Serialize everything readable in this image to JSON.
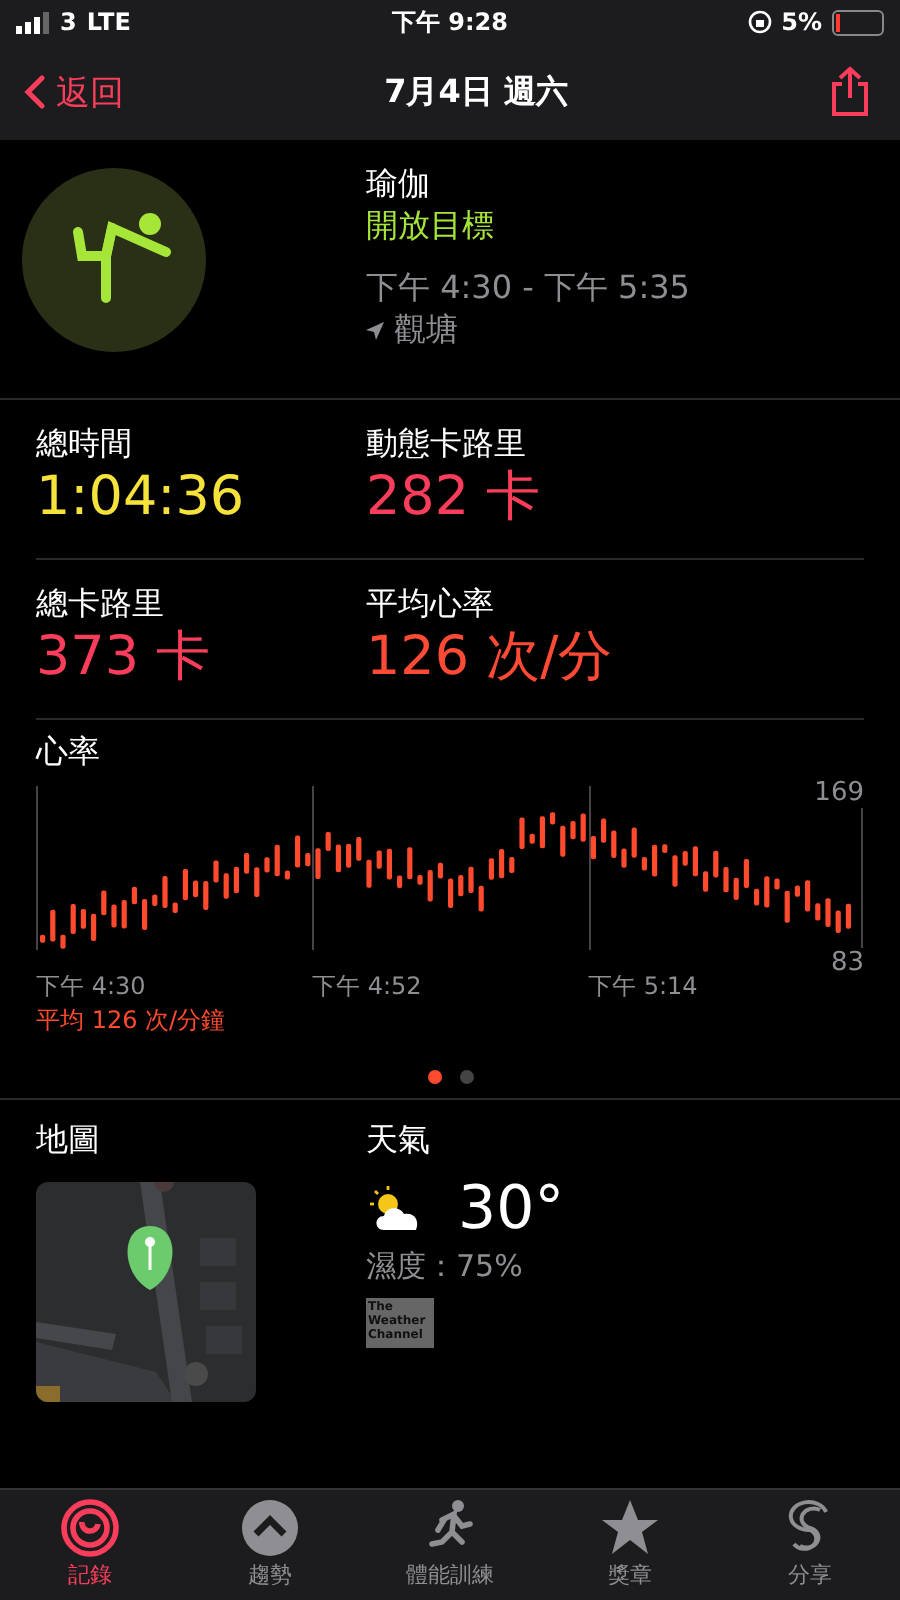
{
  "status_bar": {
    "carrier": "3",
    "network": "LTE",
    "time": "下午 9:28",
    "battery": "5%"
  },
  "nav": {
    "back": "返回",
    "title": "7月4日 週六"
  },
  "workout": {
    "name": "瑜伽",
    "goal": "開放目標",
    "time_range": "下午 4:30 - 下午 5:35",
    "location": "觀塘"
  },
  "stats": [
    {
      "label": "總時間",
      "value": "1:04:36",
      "color": "#f5e33c"
    },
    {
      "label": "動態卡路里",
      "value": "282 卡",
      "color": "#fa3d5a"
    },
    {
      "label": "總卡路里",
      "value": "373 卡",
      "color": "#fa3d5a"
    },
    {
      "label": "平均心率",
      "value": "126 次/分",
      "color": "#ff4a36"
    }
  ],
  "heart_rate": {
    "title": "心率",
    "max": "169",
    "min": "83",
    "time_labels": [
      "下午 4:30",
      "下午 4:52",
      "下午 5:14"
    ],
    "average": "平均 126 次/分鐘",
    "pages": [
      {
        "selected": true
      },
      {
        "selected": false
      }
    ]
  },
  "map": {
    "title": "地圖"
  },
  "weather": {
    "title": "天氣",
    "temperature": "30°",
    "humidity": "濕度：75%",
    "logo": "The Weather Channel"
  },
  "tab_bar": [
    {
      "label": "記錄",
      "selected": true,
      "kind": "rings"
    },
    {
      "label": "趨勢",
      "selected": false,
      "kind": "trends"
    },
    {
      "label": "體能訓練",
      "selected": false,
      "kind": "workout"
    },
    {
      "label": "獎章",
      "selected": false,
      "kind": "awards"
    },
    {
      "label": "分享",
      "selected": false,
      "kind": "sharing"
    }
  ]
}
